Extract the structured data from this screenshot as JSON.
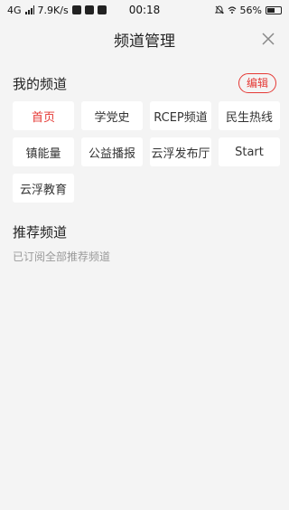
{
  "status_bar": {
    "network": "4G",
    "speed": "7.9K/s",
    "time": "00:18",
    "battery": "56%",
    "battery_level": 0.56
  },
  "header": {
    "title": "频道管理"
  },
  "my_channels": {
    "title": "我的频道",
    "edit_label": "编辑",
    "items": [
      {
        "label": "首页"
      },
      {
        "label": "学党史"
      },
      {
        "label": "RCEP频道"
      },
      {
        "label": "民生热线"
      },
      {
        "label": "镇能量"
      },
      {
        "label": "公益播报"
      },
      {
        "label": "云浮发布厅"
      },
      {
        "label": "Start"
      },
      {
        "label": "云浮教育"
      }
    ],
    "active_color": "#e53935"
  },
  "recommended": {
    "title": "推荐频道",
    "note": "已订阅全部推荐频道"
  }
}
